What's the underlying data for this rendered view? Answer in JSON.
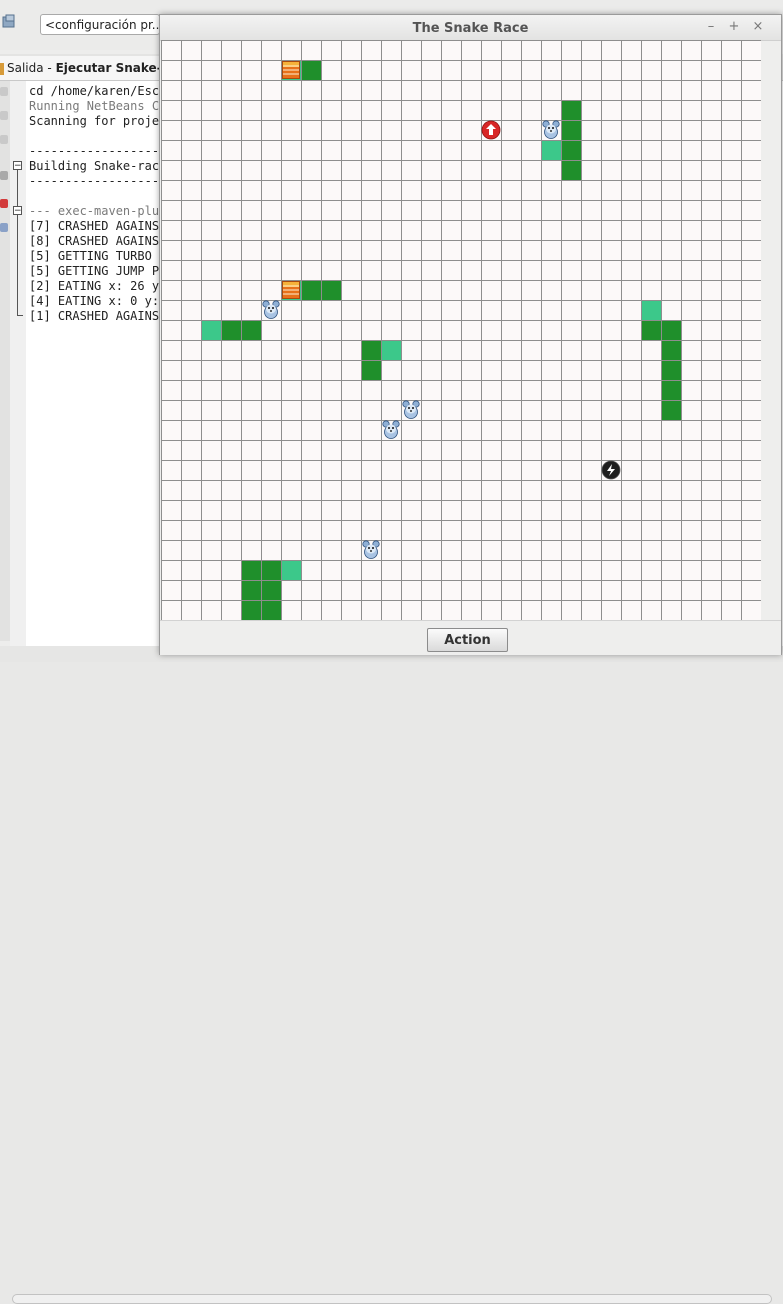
{
  "ide": {
    "config_dropdown": "<configuración pr...",
    "output_tab": {
      "prefix": "Salida - ",
      "title": "Ejecutar Snake-rac"
    },
    "output_lines": [
      {
        "text": "cd /home/karen/Escr",
        "muted": false
      },
      {
        "text": "Running NetBeans Co",
        "muted": true
      },
      {
        "text": "Scanning for projec",
        "muted": false
      },
      {
        "text": "",
        "muted": false
      },
      {
        "text": "--------------------",
        "muted": false
      },
      {
        "text": "Building Snake-race",
        "muted": false
      },
      {
        "text": "--------------------",
        "muted": false
      },
      {
        "text": "",
        "muted": false
      },
      {
        "text": "--- exec-maven-plug",
        "muted": true
      },
      {
        "text": "[7] CRASHED AGAINST",
        "muted": false
      },
      {
        "text": "[8] CRASHED AGAINST",
        "muted": false
      },
      {
        "text": "[5] GETTING TURBO B",
        "muted": false
      },
      {
        "text": "[5] GETTING JUMP PA",
        "muted": false
      },
      {
        "text": "[2] EATING x: 26 y:",
        "muted": false
      },
      {
        "text": "[4] EATING x: 0 y:",
        "muted": false
      },
      {
        "text": "[1] CRASHED AGAINST",
        "muted": false
      }
    ],
    "right_fragment": "st"
  },
  "window": {
    "title": "The Snake Race",
    "minimize": "–",
    "maximize": "+",
    "close": "×"
  },
  "board": {
    "cols": 30,
    "rows": 29,
    "colors": {
      "background": "#fcf9f9",
      "grid": "#8e8e8e",
      "snake_body": "#1f8f2b",
      "snake_head": "#3cc88a",
      "barrier": "#e8711a",
      "red_cell": "#d82626",
      "turbo": "#1e1e1e"
    },
    "snakes": [
      {
        "head": [
          19,
          5
        ],
        "body": [
          [
            20,
            3
          ],
          [
            20,
            4
          ],
          [
            20,
            5
          ],
          [
            20,
            6
          ]
        ]
      },
      {
        "head": [
          24,
          13
        ],
        "body": [
          [
            24,
            14
          ],
          [
            25,
            14
          ],
          [
            25,
            15
          ],
          [
            25,
            16
          ],
          [
            25,
            17
          ],
          [
            25,
            18
          ]
        ]
      },
      {
        "head": [
          2,
          14
        ],
        "body": [
          [
            3,
            14
          ],
          [
            4,
            14
          ]
        ]
      },
      {
        "head": [
          11,
          15
        ],
        "body": [
          [
            10,
            15
          ],
          [
            10,
            16
          ]
        ]
      },
      {
        "head": [
          6,
          26
        ],
        "body": [
          [
            4,
            26
          ],
          [
            5,
            26
          ],
          [
            5,
            27
          ],
          [
            4,
            27
          ],
          [
            5,
            28
          ],
          [
            4,
            28
          ]
        ]
      },
      {
        "head": [
          6,
          12
        ],
        "body": [
          [
            7,
            12
          ],
          [
            8,
            12
          ]
        ]
      },
      {
        "head": [
          6,
          1
        ],
        "body": [
          [
            7,
            1
          ]
        ]
      }
    ],
    "barriers": [
      [
        6,
        1
      ],
      [
        6,
        12
      ]
    ],
    "mice": [
      [
        19,
        4
      ],
      [
        5,
        13
      ],
      [
        12,
        18
      ],
      [
        11,
        19
      ],
      [
        10,
        25
      ]
    ],
    "jump_pads": [
      [
        16,
        4
      ]
    ],
    "turbo_boosts": [
      [
        22,
        21
      ]
    ],
    "icons": {
      "mouse": "mouse-icon",
      "barrier": "barrier-icon",
      "jump_pad": "jump-pad-icon",
      "turbo": "turbo-icon"
    }
  },
  "action_button": "Action"
}
